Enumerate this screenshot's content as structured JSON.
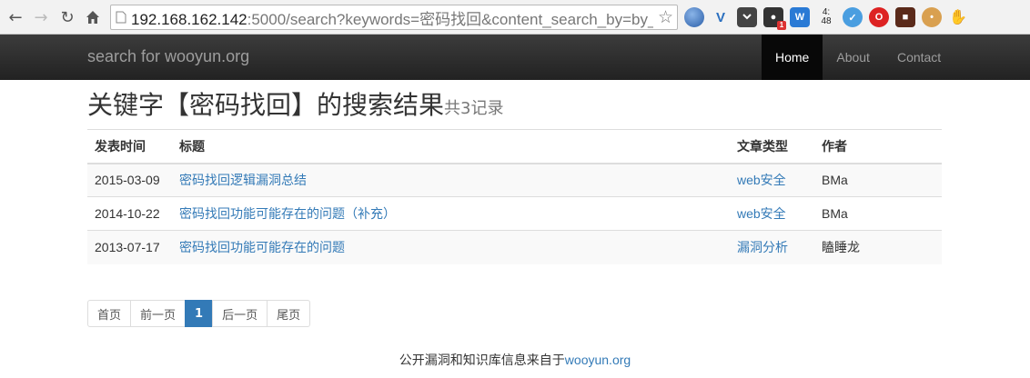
{
  "browser": {
    "url_host": "192.168.162.142",
    "url_rest": ":5000/search?keywords=密码找回&content_search_by=by_",
    "extensions": [
      "globe-icon",
      "v-icon",
      "pocket-icon",
      "camera-icon",
      "w-icon",
      "clock-icon",
      "pen-icon",
      "opera-icon",
      "ninja-icon",
      "cookie-icon",
      "hand-icon"
    ],
    "extension_badge": "1",
    "clock_text_top": "4:",
    "clock_text_bottom": "48"
  },
  "navbar": {
    "brand": "search for wooyun.org",
    "links": [
      {
        "label": "Home",
        "active": true
      },
      {
        "label": "About",
        "active": false
      },
      {
        "label": "Contact",
        "active": false
      }
    ]
  },
  "search": {
    "title": "关键字【密码找回】的搜索结果",
    "count_label": "共3记录"
  },
  "table": {
    "headers": [
      "发表时间",
      "标题",
      "文章类型",
      "作者"
    ],
    "rows": [
      {
        "date": "2015-03-09",
        "title": "密码找回逻辑漏洞总结",
        "type": "web安全",
        "author": "BMa"
      },
      {
        "date": "2014-10-22",
        "title": "密码找回功能可能存在的问题（补充）",
        "type": "web安全",
        "author": "BMa"
      },
      {
        "date": "2013-07-17",
        "title": "密码找回功能可能存在的问题",
        "type": "漏洞分析",
        "author": "瞌睡龙"
      }
    ]
  },
  "pagination": {
    "first": "首页",
    "prev": "前一页",
    "current": "1",
    "next": "后一页",
    "last": "尾页"
  },
  "footer": {
    "text": "公开漏洞和知识库信息来自于",
    "link": "wooyun.org"
  },
  "colors": {
    "link": "#337ab7",
    "navbar_bg": "#222222",
    "active_page": "#337ab7"
  }
}
